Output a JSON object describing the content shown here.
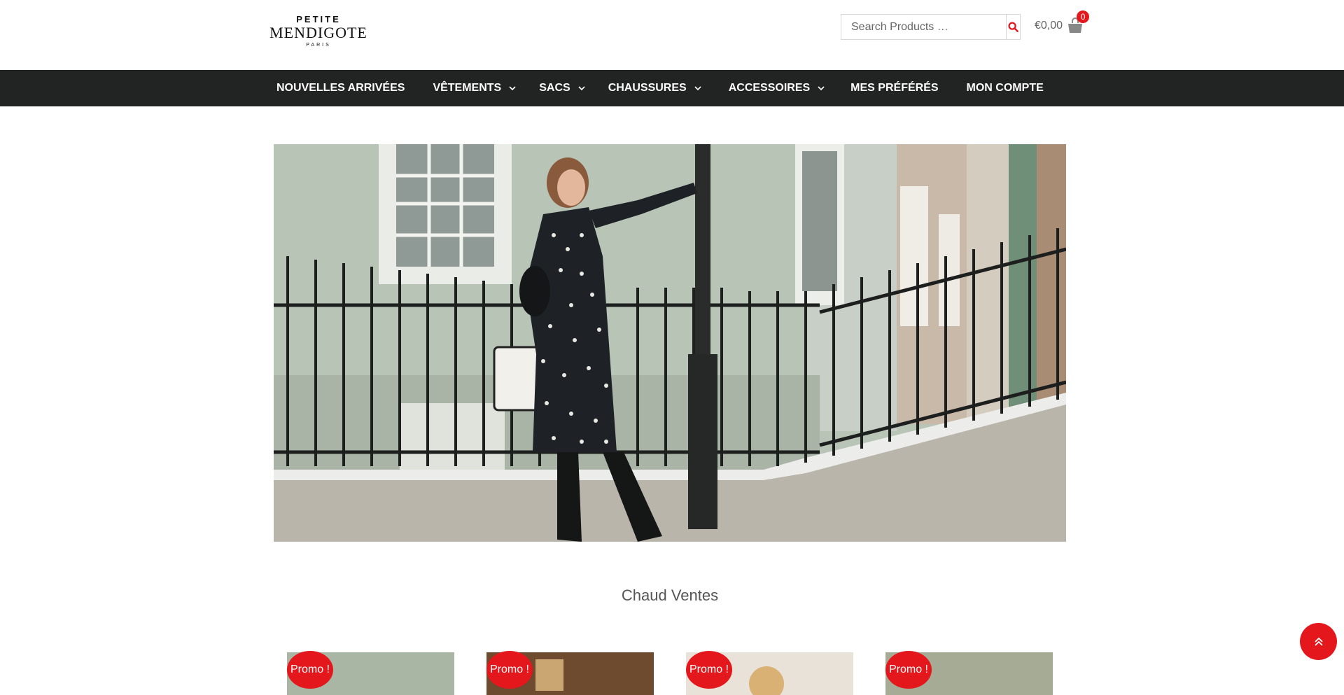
{
  "brand": {
    "line1": "PETITE",
    "line2": "MENDIGOTE",
    "line3": "PARIS"
  },
  "search": {
    "placeholder": "Search Products …",
    "icon": "search-icon"
  },
  "cart": {
    "total": "€0,00",
    "count": "0",
    "icon": "shopping-bag-icon"
  },
  "nav": {
    "items": [
      {
        "label": "NOUVELLES ARRIVÉES",
        "has_dropdown": false
      },
      {
        "label": "VÊTEMENTS",
        "has_dropdown": true
      },
      {
        "label": "SACS",
        "has_dropdown": true
      },
      {
        "label": "CHAUSSURES",
        "has_dropdown": true
      },
      {
        "label": "ACCESSOIRES",
        "has_dropdown": true
      },
      {
        "label": "MES PRÉFÉRÉS",
        "has_dropdown": false
      },
      {
        "label": "MON COMPTE",
        "has_dropdown": false
      }
    ]
  },
  "hot_sales": {
    "title": "Chaud Ventes"
  },
  "products": [
    {
      "badge": "Promo !"
    },
    {
      "badge": "Promo !"
    },
    {
      "badge": "Promo !"
    },
    {
      "badge": "Promo !"
    }
  ],
  "back_to_top": {
    "icon": "double-chevron-up-icon"
  },
  "colors": {
    "accent": "#e3171c",
    "nav_bg": "#222323"
  }
}
